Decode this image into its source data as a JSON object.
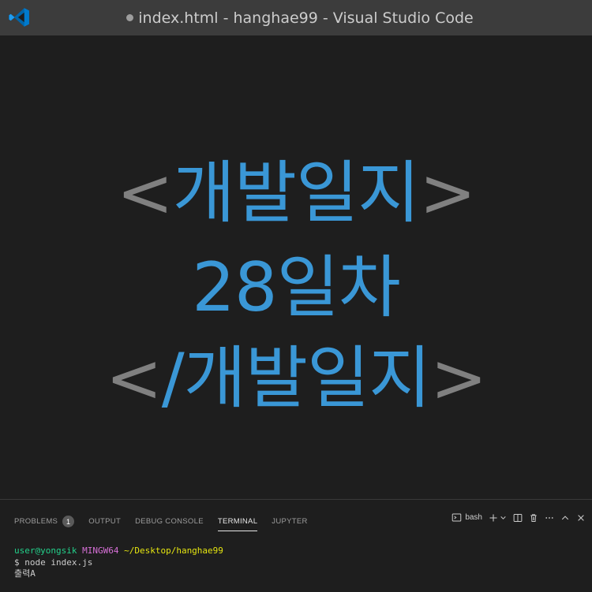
{
  "window": {
    "title": "index.html - hanghae99 - Visual Studio Code"
  },
  "editor": {
    "line1": {
      "open": "<",
      "text": "개발일지",
      "close": ">"
    },
    "line2": {
      "text": "28일차"
    },
    "line3": {
      "open": "</",
      "text": "개발일지",
      "close": ">"
    }
  },
  "panel": {
    "tabs": [
      {
        "label": "PROBLEMS",
        "badge": "1"
      },
      {
        "label": "OUTPUT"
      },
      {
        "label": "DEBUG CONSOLE"
      },
      {
        "label": "TERMINAL",
        "active": true
      },
      {
        "label": "JUPYTER"
      }
    ],
    "shell": "bash"
  },
  "terminal": {
    "user": "user@yongsik",
    "host": "MINGW64",
    "path": "~/Desktop/hanghae99",
    "command": "$ node index.js",
    "output": "출력A"
  },
  "colors": {
    "accent": "#3a97d6",
    "bracket": "#808080",
    "titlebar": "#3c3c3c",
    "editor_bg": "#1e1e1e"
  }
}
